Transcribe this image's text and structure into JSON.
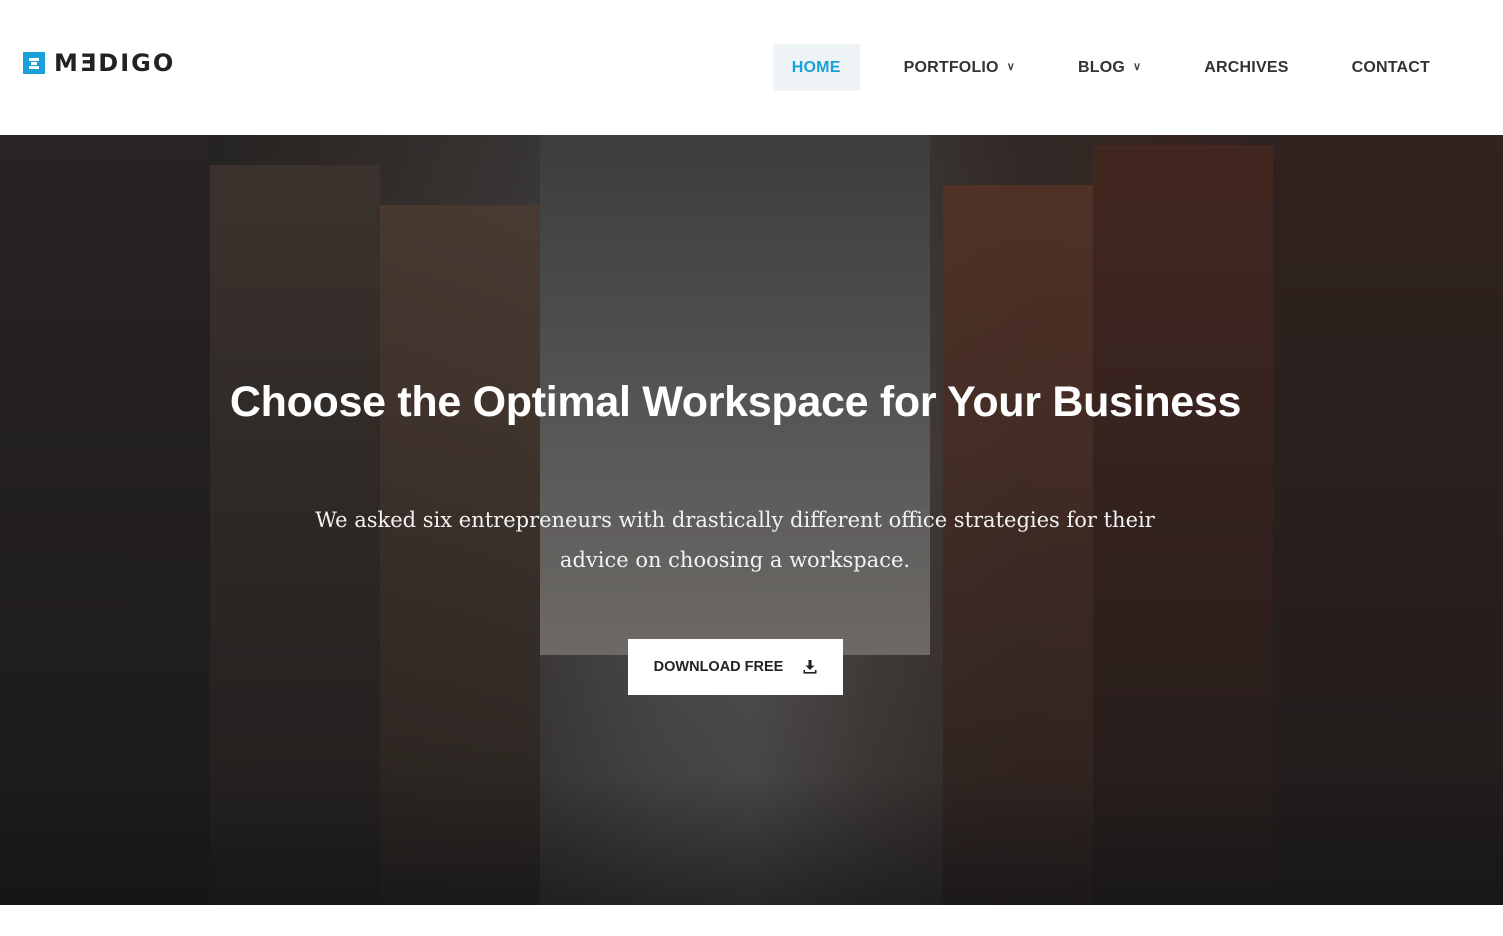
{
  "brand": {
    "name": "MƎDIGO",
    "accent_color": "#1aa0d8"
  },
  "nav": {
    "items": [
      {
        "label": "HOME",
        "active": true,
        "has_dropdown": false
      },
      {
        "label": "PORTFOLIO",
        "active": false,
        "has_dropdown": true
      },
      {
        "label": "BLOG",
        "active": false,
        "has_dropdown": true
      },
      {
        "label": "ARCHIVES",
        "active": false,
        "has_dropdown": false
      },
      {
        "label": "CONTACT",
        "active": false,
        "has_dropdown": false
      }
    ],
    "dropdown_icon": "chevron-down-icon"
  },
  "hero": {
    "title": "Choose the Optimal Workspace for Your Business",
    "subtitle": "We asked six entrepreneurs with drastically different office strategies for their advice on choosing a workspace.",
    "cta": {
      "label": "DOWNLOAD FREE",
      "icon": "download-icon"
    }
  }
}
